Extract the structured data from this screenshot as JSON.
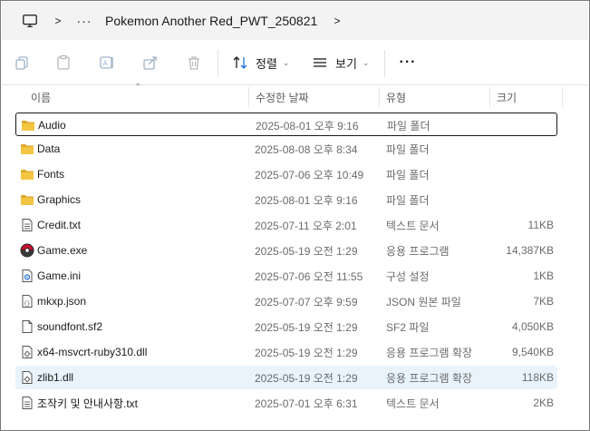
{
  "address": {
    "title": "Pokemon Another Red_PWT_250821",
    "chevron": ">",
    "more": "···",
    "chevron_end": ">"
  },
  "toolbar": {
    "sort_label": "정렬",
    "view_label": "보기",
    "more_label": "···",
    "caret": "⌄"
  },
  "columns": {
    "name": "이름",
    "modified": "수정한 날짜",
    "type": "유형",
    "size": "크기",
    "sort_indicator": "⌃"
  },
  "files": [
    {
      "name": "Audio",
      "modified": "2025-08-01 오후 9:16",
      "type": "파일 폴더",
      "size": "",
      "icon": "folder-icon"
    },
    {
      "name": "Data",
      "modified": "2025-08-08 오후 8:34",
      "type": "파일 폴더",
      "size": "",
      "icon": "folder-icon"
    },
    {
      "name": "Fonts",
      "modified": "2025-07-06 오후 10:49",
      "type": "파일 폴더",
      "size": "",
      "icon": "folder-icon"
    },
    {
      "name": "Graphics",
      "modified": "2025-08-01 오후 9:16",
      "type": "파일 폴더",
      "size": "",
      "icon": "folder-icon"
    },
    {
      "name": "Credit.txt",
      "modified": "2025-07-11 오후 2:01",
      "type": "텍스트 문서",
      "size": "11KB",
      "icon": "text-file-icon"
    },
    {
      "name": "Game.exe",
      "modified": "2025-05-19 오전 1:29",
      "type": "응용 프로그램",
      "size": "14,387KB",
      "icon": "pokeball-app-icon"
    },
    {
      "name": "Game.ini",
      "modified": "2025-07-06 오전 11:55",
      "type": "구성 설정",
      "size": "1KB",
      "icon": "settings-file-icon"
    },
    {
      "name": "mkxp.json",
      "modified": "2025-07-07 오후 9:59",
      "type": "JSON 원본 파일",
      "size": "7KB",
      "icon": "json-file-icon"
    },
    {
      "name": "soundfont.sf2",
      "modified": "2025-05-19 오전 1:29",
      "type": "SF2 파일",
      "size": "4,050KB",
      "icon": "blank-file-icon"
    },
    {
      "name": "x64-msvcrt-ruby310.dll",
      "modified": "2025-05-19 오전 1:29",
      "type": "응용 프로그램 확장",
      "size": "9,540KB",
      "icon": "dll-file-icon"
    },
    {
      "name": "zlib1.dll",
      "modified": "2025-05-19 오전 1:29",
      "type": "응용 프로그램 확장",
      "size": "118KB",
      "icon": "dll-file-icon"
    },
    {
      "name": "조작키 및 안내사항.txt",
      "modified": "2025-07-01 오후 6:31",
      "type": "텍스트 문서",
      "size": "2KB",
      "icon": "text-file-icon"
    }
  ],
  "selected_index": 0,
  "hover_index": 10,
  "colors": {
    "folder": "#f4c542",
    "folder_dark": "#e0a82e",
    "accent": "#1e6fd9",
    "hover": "#e8f3fc",
    "disabled_icon": "#9fb3c8"
  }
}
